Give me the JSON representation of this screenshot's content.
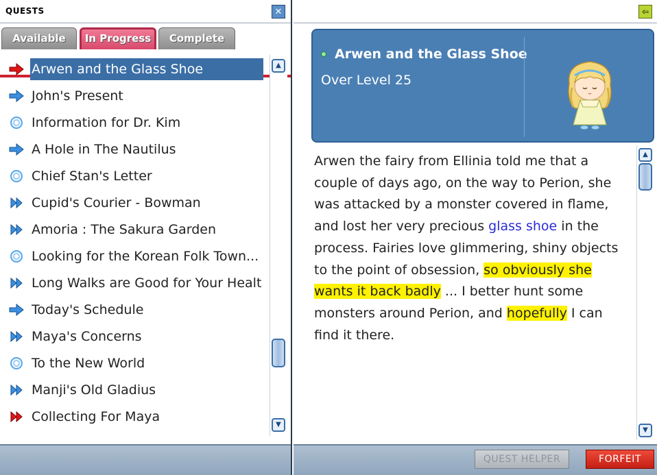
{
  "window": {
    "title": "QUESTS",
    "close_icon": "close-icon",
    "back_icon": "back-arrow-icon"
  },
  "tabs": [
    {
      "label": "Available",
      "selected": false
    },
    {
      "label": "In Progress",
      "selected": true
    },
    {
      "label": "Complete",
      "selected": false
    }
  ],
  "quest_list": [
    {
      "label": "Arwen and the Glass Shoe",
      "icon": "red-arrow-icon",
      "selected": true
    },
    {
      "label": "John's Present",
      "icon": "blue-arrow-icon"
    },
    {
      "label": "Information for Dr. Kim",
      "icon": "blue-ring-icon"
    },
    {
      "label": "A Hole in The Nautilus",
      "icon": "blue-arrow-icon"
    },
    {
      "label": "Chief Stan's Letter",
      "icon": "blue-ring-icon"
    },
    {
      "label": "Cupid's Courier - Bowman",
      "icon": "blue-double-arrow-icon"
    },
    {
      "label": "Amoria : The Sakura Garden",
      "icon": "blue-double-arrow-icon"
    },
    {
      "label": "Looking for the Korean Folk Town...",
      "icon": "blue-ring-icon"
    },
    {
      "label": "Long Walks are Good for Your Healt",
      "icon": "blue-double-arrow-icon"
    },
    {
      "label": "Today's Schedule",
      "icon": "blue-arrow-icon"
    },
    {
      "label": "Maya's Concerns",
      "icon": "blue-double-arrow-icon"
    },
    {
      "label": "To the New World",
      "icon": "blue-ring-icon"
    },
    {
      "label": "Manji's Old Gladius",
      "icon": "blue-double-arrow-icon"
    },
    {
      "label": "Collecting For Maya",
      "icon": "red-double-arrow-icon"
    }
  ],
  "detail": {
    "title": "Arwen and the Glass Shoe",
    "level": "Over Level 25",
    "portrait_icon": "fairy-portrait-icon",
    "description": {
      "p1": "Arwen the fairy from Ellinia told me that a couple of days ago, on the way to Perion, she was attacked by a monster covered in flame, and lost her very precious ",
      "link": "glass shoe",
      "p2": " in the process. Fairies love glimmering, shiny objects to the point of obsession, ",
      "hl1": "so obviously she wants it back badly",
      "p3": " ... I better hunt some monsters around Perion, and ",
      "hl2": "hopefully",
      "p4": " I can find it there."
    }
  },
  "footer": {
    "quest_helper_label": "QUEST HELPER",
    "forfeit_label": "FORFEIT"
  },
  "colors": {
    "selected_row": "#3a6ea5",
    "active_tab": "#d84a6b",
    "header_card": "#4a7fb4",
    "highlight": "#fff200",
    "link": "#2a2ad8",
    "forfeit": "#c41f14"
  }
}
